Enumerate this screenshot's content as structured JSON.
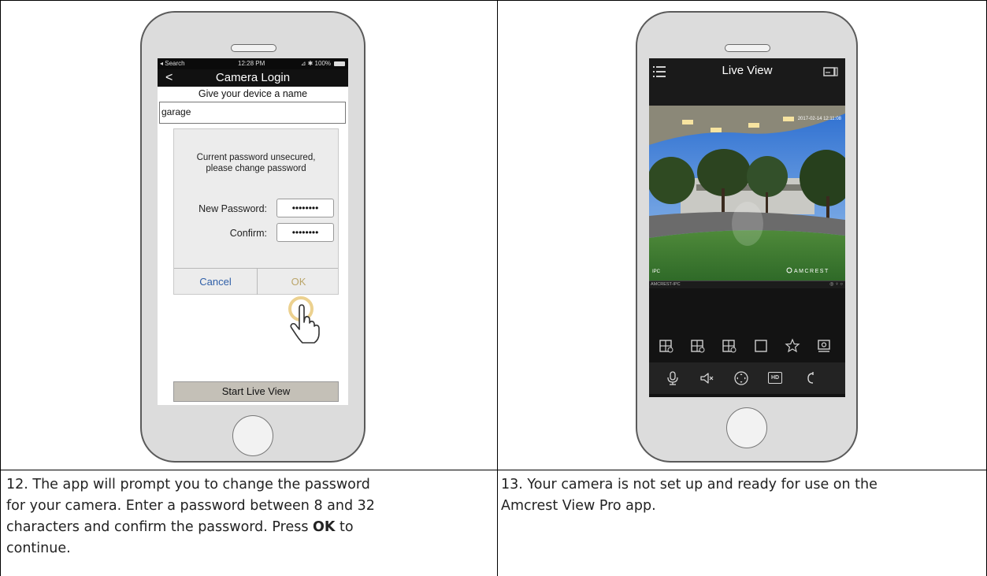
{
  "left_phone": {
    "status": {
      "carrier": "◂ Search",
      "time": "12:28 PM",
      "battery": "⊿ ✱ 100%"
    },
    "nav_title": "Camera Login",
    "name_prompt": "Give your device a name",
    "name_value": "garage",
    "dialog": {
      "message_line1": "Current password unsecured,",
      "message_line2": "please change password",
      "new_password_label": "New Password:",
      "new_password_value": "••••••••",
      "confirm_label": "Confirm:",
      "confirm_value": "••••••••",
      "cancel_label": "Cancel",
      "ok_label": "OK"
    },
    "start_live_label": "Start Live View"
  },
  "right_phone": {
    "title": "Live View",
    "timestamp": "2017-02-14 12:11:08",
    "channel_label": "IPC",
    "brand": "AMCREST",
    "device_name": "AMCREST-IPC",
    "hd_label": "HD"
  },
  "captions": {
    "step12_prefix": "12. The app will prompt you to change the password",
    "step12_line2": "for your camera. Enter a password between 8 and 32",
    "step12_line3_prefix": "characters and confirm the password. Press ",
    "step12_bold": "OK",
    "step12_line3_suffix": " to",
    "step12_line4": "continue.",
    "step13_line1": "13. Your camera is not set up and ready for use on the",
    "step13_line2": "Amcrest View Pro app."
  }
}
